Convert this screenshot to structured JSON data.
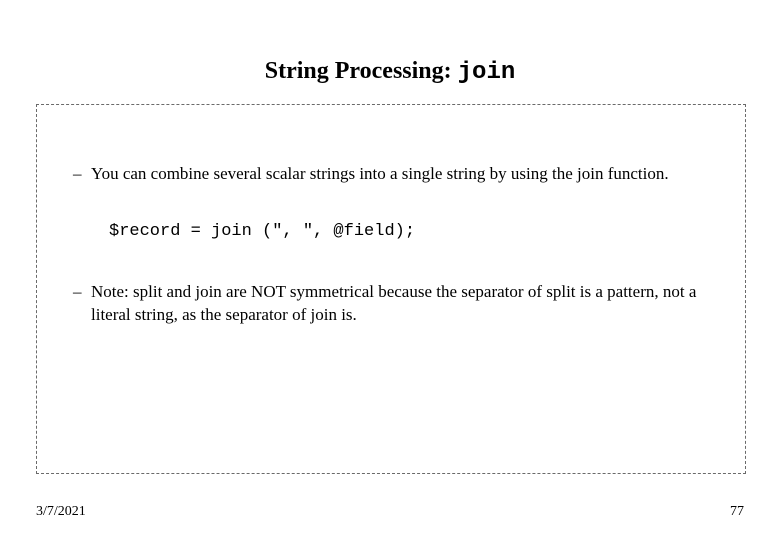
{
  "title": {
    "prefix": "String Processing: ",
    "mono": "join"
  },
  "bullets": [
    "You can combine several scalar strings into a single string by using the join function.",
    "Note: split and join are NOT symmetrical because the separator of split is a pattern, not a literal string, as the separator of join is."
  ],
  "code": "$record = join (\", \", @field);",
  "footer": {
    "date": "3/7/2021",
    "page": "77"
  },
  "dash": "–"
}
